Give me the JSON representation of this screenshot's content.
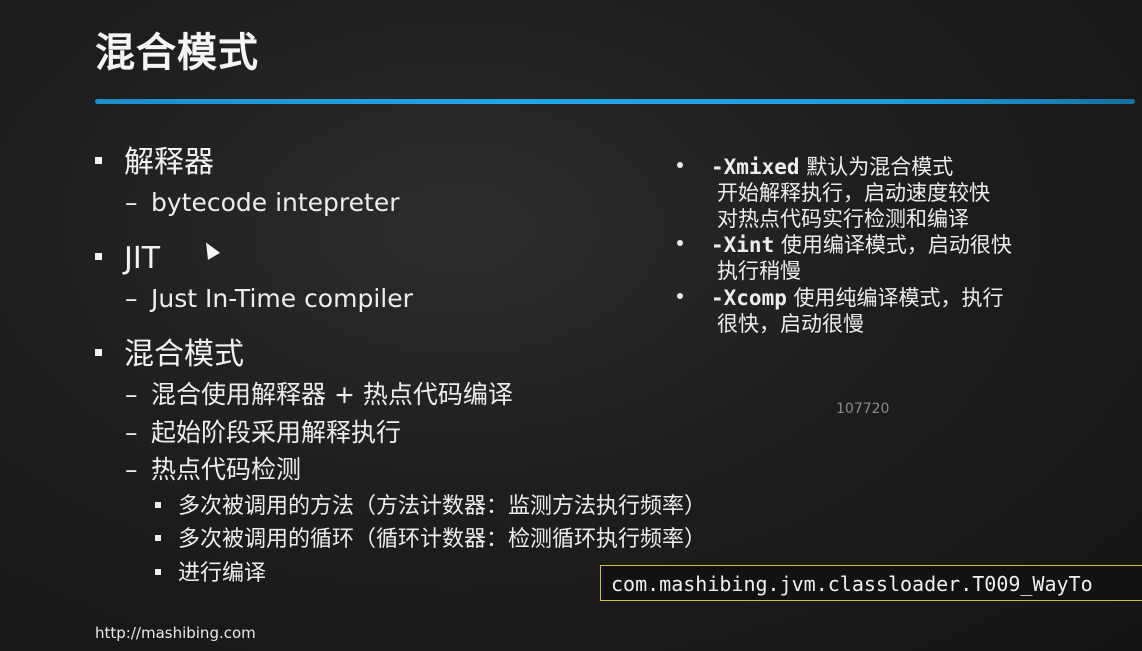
{
  "slide": {
    "title": "混合模式",
    "left": {
      "b1": "解释器",
      "b1_sub": "bytecode intepreter",
      "b2": "JIT",
      "b2_sub": "Just In-Time compiler",
      "b3": "混合模式",
      "b3_sub1": "混合使用解释器 + 热点代码编译",
      "b3_sub2": "起始阶段采用解释执行",
      "b3_sub3": "热点代码检测",
      "b3_sub3_items": [
        "多次被调用的方法（方法计数器：监测方法执行频率）",
        "多次被调用的循环（循环计数器：检测循环执行频率）",
        "进行编译"
      ]
    },
    "right": {
      "r1_flag": "-Xmixed",
      "r1_text": "默认为混合模式",
      "r1_line2": "开始解释执行，启动速度较快",
      "r1_line3": "对热点代码实行检测和编译",
      "r2_flag": "-Xint",
      "r2_text": "使用编译模式，启动很快",
      "r2_line2": "执行稍慢",
      "r3_flag": "-Xcomp",
      "r3_text": "使用纯编译模式，执行",
      "r3_line2": "很快，启动很慢"
    },
    "watermark": "107720",
    "code_box": "com.mashibing.jvm.classloader.T009_WayTo",
    "footer_url": "http://mashibing.com"
  },
  "colors": {
    "background": "#1e1e1e",
    "accent_rule": "#22a6e8",
    "code_box_border": "#c9c23c"
  }
}
